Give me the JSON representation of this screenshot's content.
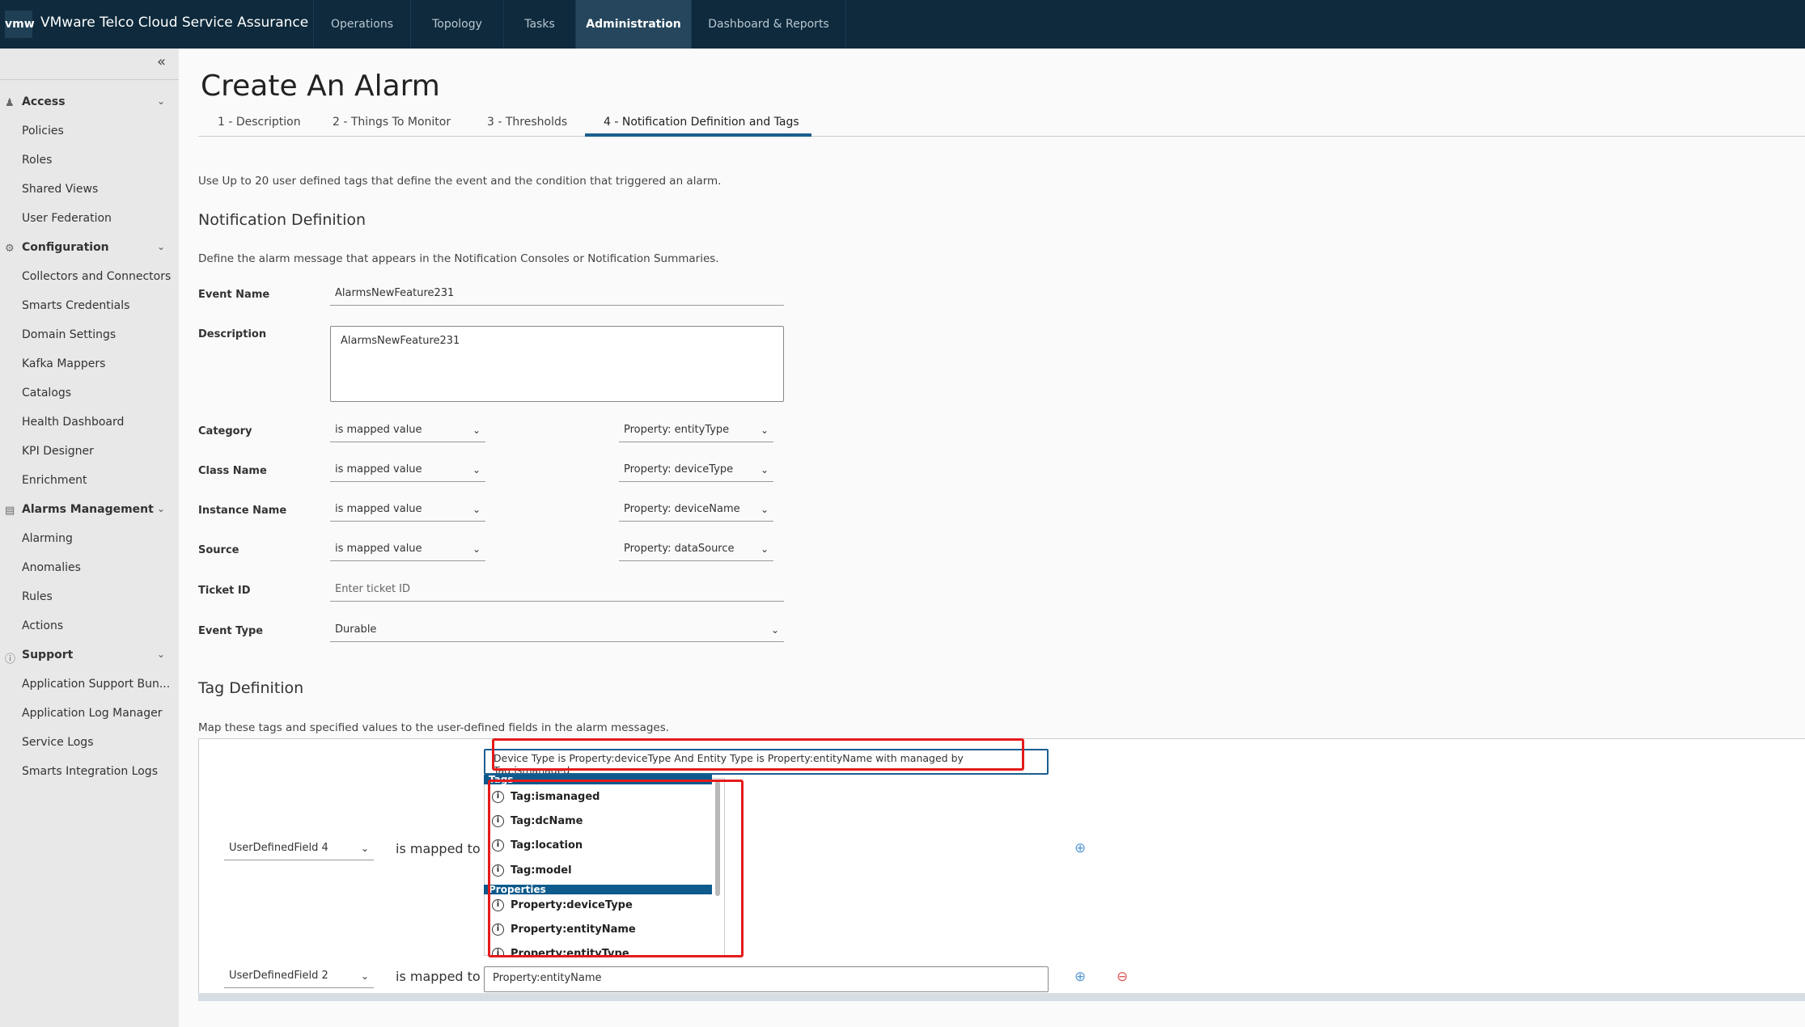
{
  "header": {
    "logo": "vmw",
    "app_title": "VMware Telco Cloud Service Assurance",
    "nav": [
      {
        "label": "Operations"
      },
      {
        "label": "Topology"
      },
      {
        "label": "Tasks"
      },
      {
        "label": "Administration",
        "active": true
      },
      {
        "label": "Dashboard & Reports"
      }
    ]
  },
  "sidebar": {
    "collapse_icon": "double-chevron-left",
    "groups": [
      {
        "label": "Access",
        "icon": "user-icon",
        "items": [
          "Policies",
          "Roles",
          "Shared Views",
          "User Federation"
        ]
      },
      {
        "label": "Configuration",
        "icon": "gear-icon",
        "items": [
          "Collectors and Connectors",
          "Smarts Credentials",
          "Domain Settings",
          "Kafka Mappers",
          "Catalogs",
          "Health Dashboard",
          "KPI Designer",
          "Enrichment"
        ]
      },
      {
        "label": "Alarms Management",
        "icon": "list-icon",
        "items": [
          "Alarming",
          "Anomalies",
          "Rules",
          "Actions"
        ]
      },
      {
        "label": "Support",
        "icon": "help-icon",
        "items": [
          "Application Support Bun...",
          "Application Log Manager",
          "Service Logs",
          "Smarts Integration Logs"
        ]
      }
    ]
  },
  "page": {
    "title": "Create An Alarm",
    "tabs": [
      {
        "label": "1 - Description"
      },
      {
        "label": "2 - Things To Monitor"
      },
      {
        "label": "3 - Thresholds"
      },
      {
        "label": "4 - Notification Definition and Tags",
        "active": true
      }
    ],
    "intro": "Use Up to 20 user defined tags that define the event and the condition that triggered an alarm.",
    "notification": {
      "heading": "Notification Definition",
      "desc": "Define the alarm message that appears in the Notification Consoles or Notification Summaries.",
      "event_name_label": "Event Name",
      "event_name": "AlarmsNewFeature231",
      "description_label": "Description",
      "description": "AlarmsNewFeature231",
      "rows": [
        {
          "label": "Category",
          "mode": "is mapped value",
          "property": "Property: entityType"
        },
        {
          "label": "Class Name",
          "mode": "is mapped value",
          "property": "Property: deviceType"
        },
        {
          "label": "Instance Name",
          "mode": "is mapped value",
          "property": "Property: deviceName"
        },
        {
          "label": "Source",
          "mode": "is mapped value",
          "property": "Property: dataSource"
        }
      ],
      "ticket_label": "Ticket ID",
      "ticket_placeholder": "Enter ticket ID",
      "event_type_label": "Event Type",
      "event_type": "Durable"
    },
    "tags": {
      "heading": "Tag Definition",
      "desc": "Map these tags and specified values to the user-defined fields in the alarm messages.",
      "mapped_label": "is mapped to",
      "row1": {
        "field": "UserDefinedField 4",
        "value": "Device Type is Property:deviceType And Entity Type is Property:entityName with managed by Tag:ismanaged"
      },
      "dropdown": {
        "tags_header": "Tags",
        "tags": [
          "Tag:ismanaged",
          "Tag:dcName",
          "Tag:location",
          "Tag:model"
        ],
        "properties_header": "Properties",
        "properties": [
          "Property:deviceType",
          "Property:entityName",
          "Property:entityType"
        ]
      },
      "row2": {
        "field": "UserDefinedField 2",
        "value": "Property:entityName"
      },
      "highlight_color": "#e41b1b",
      "accent": "#0d5a8c"
    }
  }
}
